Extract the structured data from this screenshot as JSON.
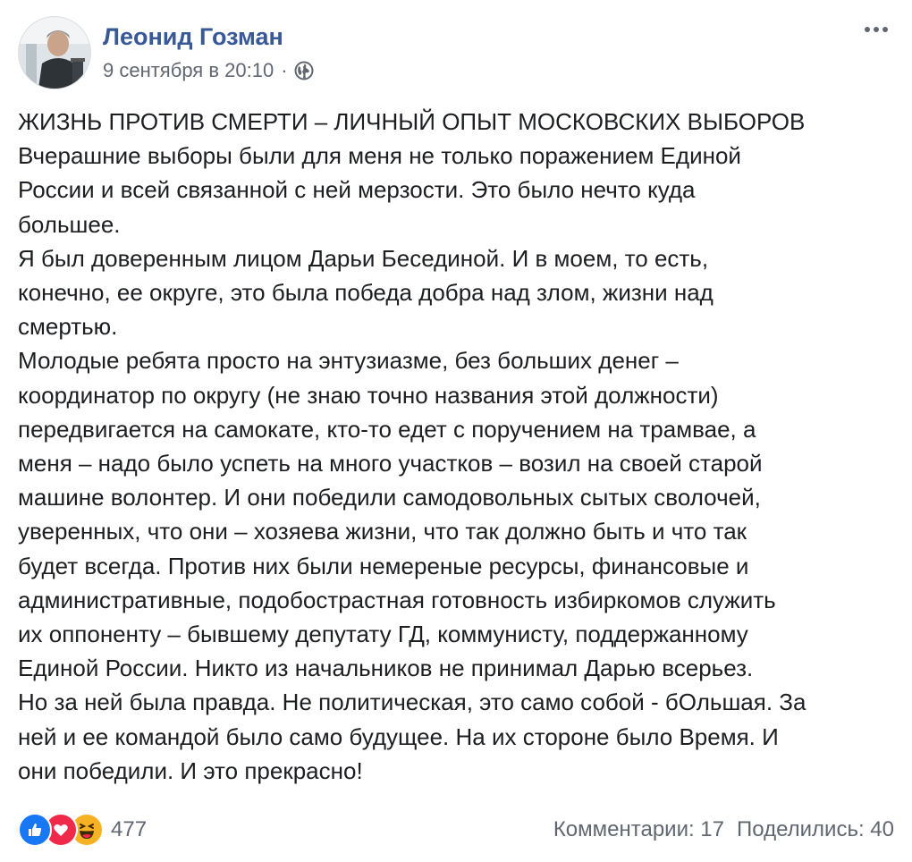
{
  "post": {
    "author": "Леонид Гозман",
    "timestamp": "9 сентября в 20:10",
    "separator": "·",
    "privacy_icon": "globe-icon",
    "more_icon": "more-horizontal-icon",
    "lines": [
      "ЖИЗНЬ ПРОТИВ СМЕРТИ – ЛИЧНЫЙ ОПЫТ МОСКОВСКИХ ВЫБОРОВ",
      "Вчерашние выборы были для меня не только поражением Единой",
      "России и всей связанной с ней мерзости. Это было нечто куда",
      "большее.",
      "Я был доверенным лицом Дарьи Бесединой. И в моем, то есть,",
      "конечно, ее округе, это была победа добра над злом, жизни над",
      "смертью.",
      "Молодые ребята просто на энтузиазме, без больших денег –",
      "координатор по округу (не знаю точно названия этой должности)",
      "передвигается на самокате, кто-то едет с поручением на трамвае, а",
      "меня – надо было успеть на много участков – возил на своей старой",
      "машине волонтер. И они победили самодовольных сытых сволочей,",
      "уверенных, что они – хозяева жизни, что так должно быть и что так",
      "будет всегда. Против них были немереные ресурсы, финансовые и",
      "административные, подобострастная готовность избиркомов служить",
      "их оппоненту – бывшему депутату ГД, коммунисту, поддержанному",
      "Единой России. Никто из начальников не принимал Дарью всерьез.",
      "Но за ней была правда. Не политическая, это само собой - бОльшая. За",
      "ней и ее командой было само будущее. На их стороне было Время. И",
      "они победили. И это прекрасно!"
    ]
  },
  "footer": {
    "reaction_icons": [
      "like-icon",
      "love-icon",
      "haha-icon"
    ],
    "reaction_count": "477",
    "comments": "Комментарии: 17",
    "shares": "Поделились: 40"
  },
  "colors": {
    "author_link": "#385898",
    "meta_text": "#616770",
    "like": "#1877f2",
    "love": "#f0284a",
    "haha": "#f7b125"
  }
}
